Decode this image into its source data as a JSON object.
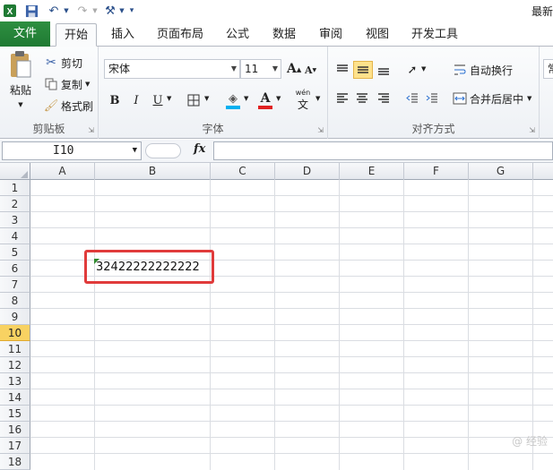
{
  "qat": {
    "title_partial": "最新"
  },
  "tabs": [
    {
      "label": "文件"
    },
    {
      "label": "开始"
    },
    {
      "label": "插入"
    },
    {
      "label": "页面布局"
    },
    {
      "label": "公式"
    },
    {
      "label": "数据"
    },
    {
      "label": "审阅"
    },
    {
      "label": "视图"
    },
    {
      "label": "开发工具"
    }
  ],
  "clipboard": {
    "paste": "粘贴",
    "cut": "剪切",
    "copy": "复制",
    "format_painter": "格式刷",
    "group": "剪贴板"
  },
  "font": {
    "name": "宋体",
    "size": "11",
    "bold": "B",
    "italic": "I",
    "underline": "U",
    "phonetic": "wén",
    "group": "字体"
  },
  "alignment": {
    "wrap_text": "自动换行",
    "merge_center": "合并后居中",
    "group": "对齐方式",
    "next_group_partial": "常"
  },
  "formula_bar": {
    "name_box": "I10",
    "fx": "fx",
    "value": ""
  },
  "grid": {
    "columns": [
      "A",
      "B",
      "C",
      "D",
      "E",
      "F",
      "G"
    ],
    "rows": [
      "1",
      "2",
      "3",
      "4",
      "5",
      "6",
      "7",
      "8",
      "9",
      "10",
      "11",
      "12",
      "13",
      "14",
      "15",
      "16",
      "17",
      "18"
    ],
    "active_row": "10",
    "cell_b6": "32422222222222"
  },
  "colors": {
    "file_tab": "#1f7a33",
    "active_row": "#f8d262",
    "annotation_box": "#e03b3b"
  },
  "watermark": "@ 经验"
}
